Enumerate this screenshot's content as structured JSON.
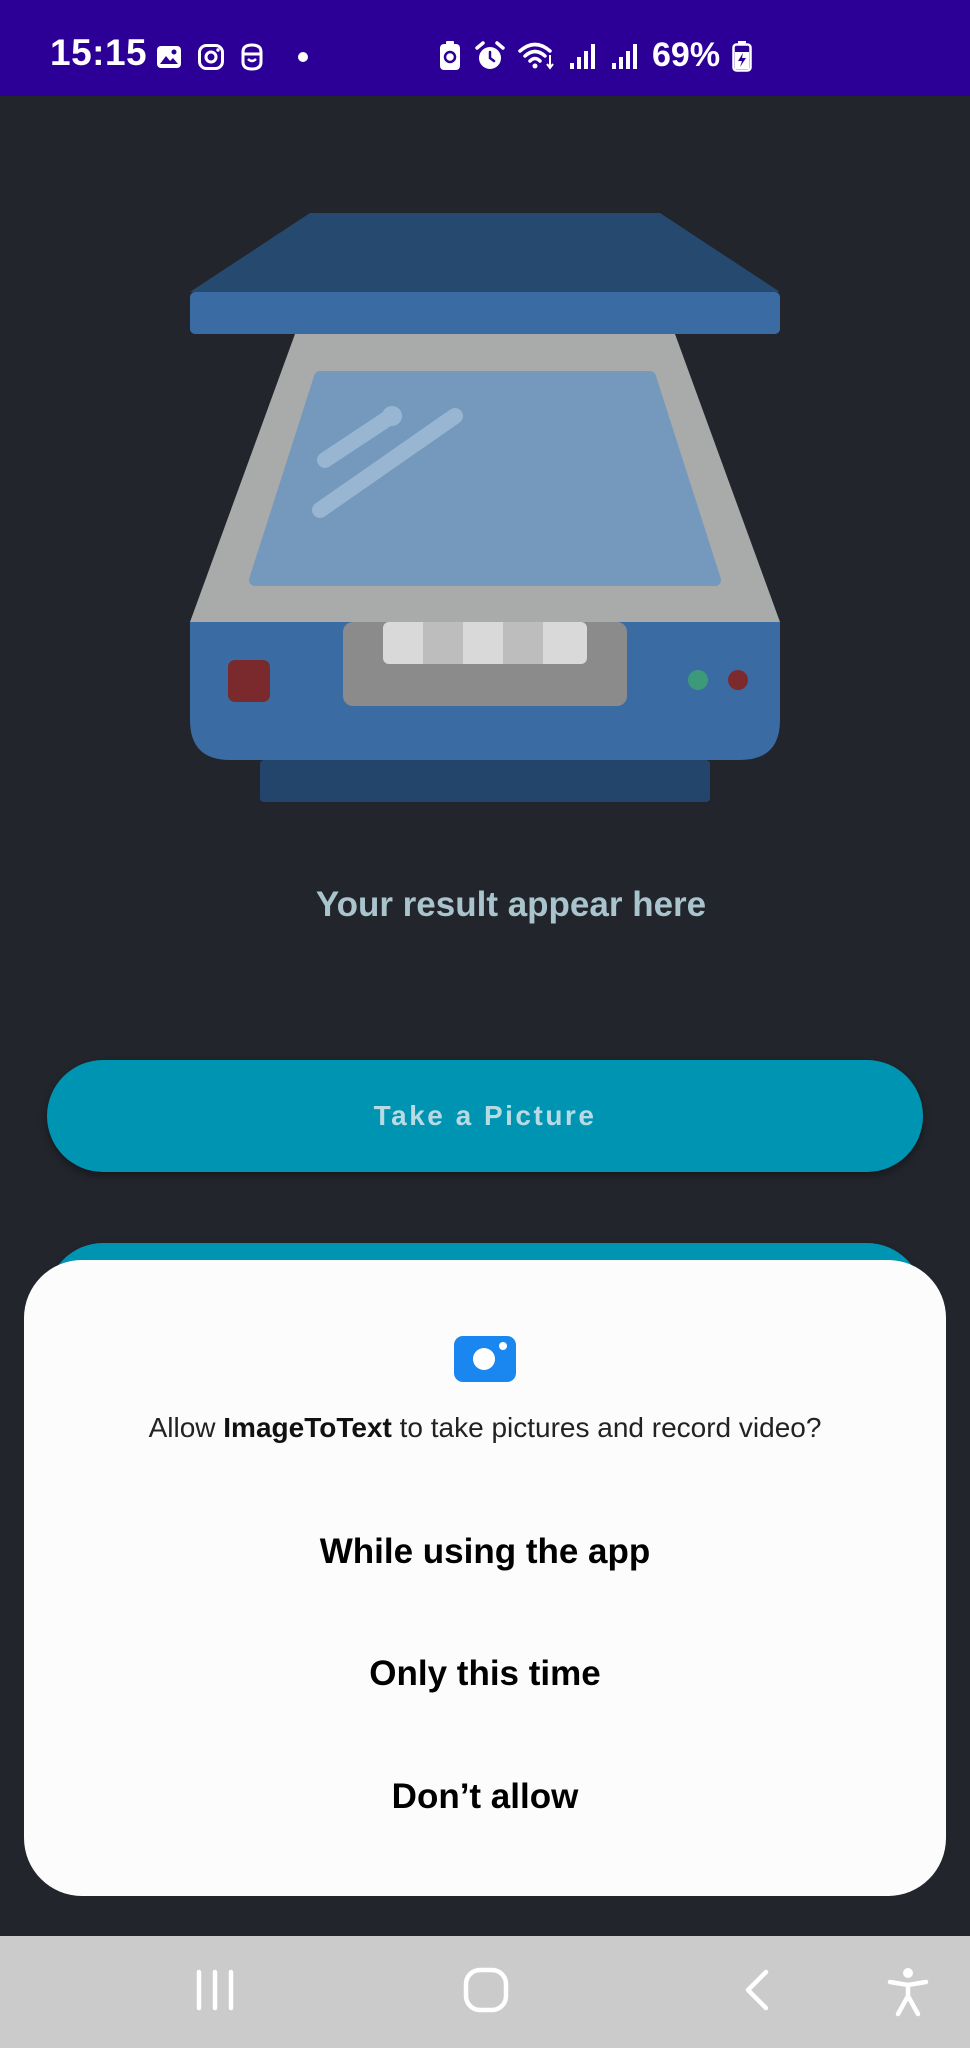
{
  "status_bar": {
    "time": "15:15",
    "battery_percent": "69%",
    "icons_left": [
      "gallery-icon",
      "instagram-icon",
      "notification-app-icon",
      "dot-icon"
    ],
    "icons_right": [
      "battery-saver-icon",
      "alarm-icon",
      "wifi-icon",
      "signal-icon",
      "signal-icon",
      "battery-icon"
    ],
    "background_color": "#2c0096"
  },
  "main": {
    "illustration": "scanner-icon",
    "result_placeholder": "Your result appear here",
    "take_picture_label": "Take a Picture",
    "accent_color": "#0094b3"
  },
  "dialog": {
    "icon": "camera-icon",
    "message_prefix": "Allow ",
    "app_name": "ImageToText",
    "message_suffix": " to take pictures and record video?",
    "options": [
      "While using the app",
      "Only this time",
      "Don’t allow"
    ]
  },
  "nav_bar": {
    "buttons": [
      "recent-apps-icon",
      "home-icon",
      "back-icon",
      "accessibility-icon"
    ]
  }
}
